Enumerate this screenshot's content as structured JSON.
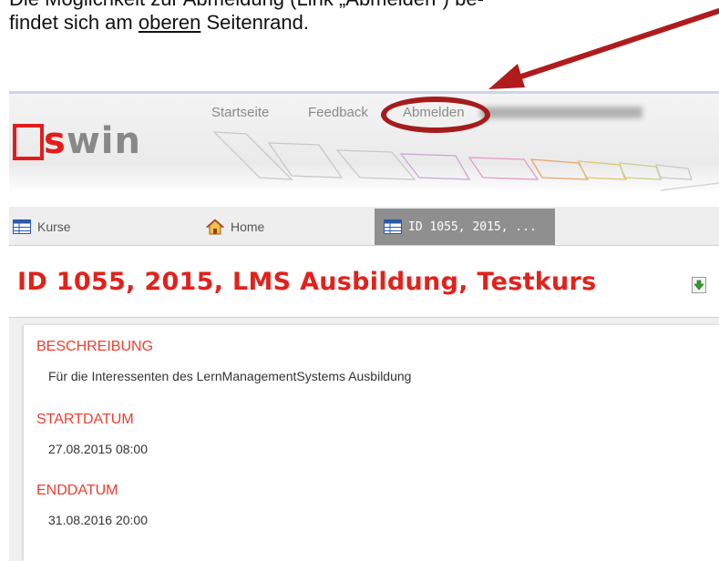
{
  "instruction": {
    "line1": "Die Möglichkeit zur Abmeldung (Link „Abmelden“) be-",
    "line2_before": "findet sich am ",
    "line2_underlined": "oberen",
    "line2_after": " Seitenrand."
  },
  "logo": {
    "letter": "s",
    "rest": "win"
  },
  "nav": {
    "startseite": "Startseite",
    "feedback": "Feedback",
    "abmelden": "Abmelden"
  },
  "tabs": [
    {
      "label": "Kurse",
      "icon": "table-icon"
    },
    {
      "label": "Home",
      "icon": "house-icon"
    },
    {
      "label": "ID 1055, 2015, ...",
      "icon": "table-icon",
      "active": true
    }
  ],
  "page": {
    "title": "ID 1055, 2015, LMS Ausbildung, Testkurs"
  },
  "details": {
    "beschreibung_label": "BESCHREIBUNG",
    "beschreibung_value": "Für die Interessenten des LernManagementSystems Ausbildung",
    "startdatum_label": "STARTDATUM",
    "startdatum_value": "27.08.2015 08:00",
    "enddatum_label": "ENDDATUM",
    "enddatum_value": "31.08.2016 20:00"
  },
  "colors": {
    "accent_red": "#e3211b",
    "label_red": "#ef3d2f",
    "annotation_red": "#a51c1c",
    "active_tab": "#8f8f8f"
  }
}
